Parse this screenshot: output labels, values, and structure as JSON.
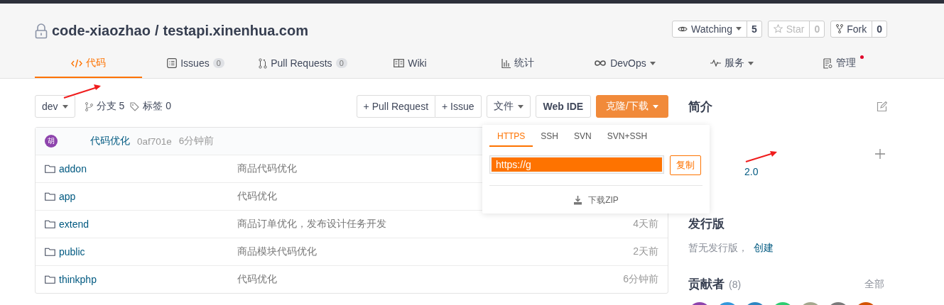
{
  "repo": {
    "owner": "code-xiaozhao",
    "separator": "/",
    "name": "testapi.xinenhua.com",
    "private": true
  },
  "actions": [
    {
      "label": "Watching",
      "count": "5",
      "dropdown": true,
      "disabled": false
    },
    {
      "label": "Star",
      "count": "0",
      "dropdown": false,
      "disabled": true
    },
    {
      "label": "Fork",
      "count": "0",
      "dropdown": false,
      "disabled": false
    }
  ],
  "tabs": [
    {
      "label": "代码",
      "selected": true,
      "dropdown": false,
      "notify": false
    },
    {
      "label": "Issues",
      "count": "0",
      "selected": false,
      "dropdown": false,
      "notify": false
    },
    {
      "label": "Pull Requests",
      "count": "0",
      "selected": false,
      "dropdown": false,
      "notify": false
    },
    {
      "label": "Wiki",
      "selected": false,
      "dropdown": false,
      "notify": false
    },
    {
      "label": "统计",
      "selected": false,
      "dropdown": false,
      "notify": false
    },
    {
      "label": "DevOps",
      "selected": false,
      "dropdown": true,
      "notify": false
    },
    {
      "label": "服务",
      "selected": false,
      "dropdown": true,
      "notify": false
    },
    {
      "label": "管理",
      "selected": false,
      "dropdown": false,
      "notify": true
    }
  ],
  "toolbar": {
    "branch": "dev",
    "branches": "分支 5",
    "tags": "标签 0",
    "buttons": [
      {
        "label": "+ Pull Request",
        "kind": "group"
      },
      {
        "label": "+ Issue",
        "kind": "group"
      },
      {
        "label": "文件",
        "kind": "dropdown"
      },
      {
        "label": "Web IDE",
        "kind": "bold"
      },
      {
        "label": "克隆/下载",
        "kind": "primary"
      }
    ]
  },
  "commit": {
    "avatar": "胡",
    "message": "代码优化",
    "hash": "0af701e",
    "time": "6分钟前"
  },
  "files": [
    {
      "name": "addon",
      "message": "商品代码优化"
    },
    {
      "name": "app",
      "message": "代码优化"
    },
    {
      "name": "extend",
      "message": "商品订单优化，发布设计任务开发",
      "time": "4天前"
    },
    {
      "name": "public",
      "message": "商品模块代码优化",
      "time": "2天前"
    },
    {
      "name": "thinkphp",
      "message": "代码优化",
      "time": "6分钟前"
    }
  ],
  "clone": {
    "tabs": [
      {
        "label": "HTTPS",
        "selected": true
      },
      {
        "label": "SSH",
        "selected": false
      },
      {
        "label": "SVN",
        "selected": false
      },
      {
        "label": "SVN+SSH",
        "selected": false
      }
    ],
    "url": "https://g",
    "copy": "复制",
    "download": "下载ZIP"
  },
  "sidebar": {
    "about_title": "简介",
    "license_fragment": "2.0",
    "releases_title": "发行版",
    "releases_empty": "暂无发行版，",
    "releases_create": "创建",
    "contributors_title": "贡献者",
    "contributors_count": "(8)",
    "contributors_all": "全部",
    "contributors": [
      {
        "color": "#8e44ad"
      },
      {
        "color": "#3498db"
      },
      {
        "color": "#2e86c1"
      },
      {
        "color": "#2ecc71"
      },
      {
        "color": "#a4a88e"
      },
      {
        "color": "#7a7a7a"
      },
      {
        "color": "#d35400"
      }
    ]
  },
  "annotations": [
    {
      "kind": "arrow"
    },
    {
      "kind": "arrow"
    }
  ]
}
